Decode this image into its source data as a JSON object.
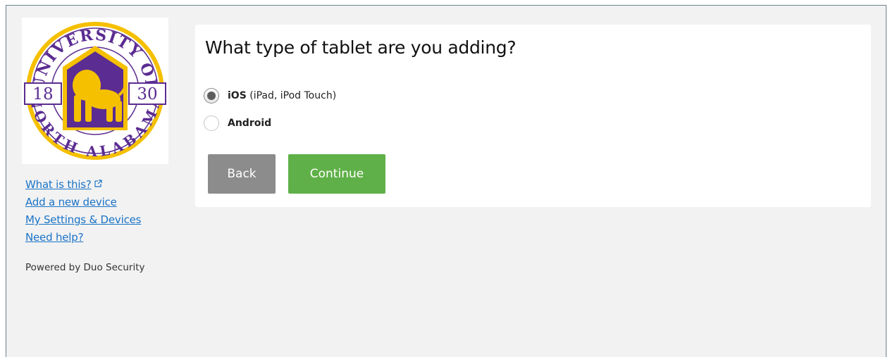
{
  "sidebar": {
    "logo": {
      "arc_top": "UNIVERSITY OF",
      "arc_bottom": "NORTH ALABAMA",
      "year_left": "18",
      "year_right": "30",
      "colors": {
        "gold": "#f5c000",
        "purple": "#5b2c91",
        "ring": "#ffffff"
      }
    },
    "links": [
      {
        "label": "What is this?",
        "icon": "external-link-icon"
      },
      {
        "label": "Add a new device"
      },
      {
        "label": "My Settings & Devices"
      },
      {
        "label": "Need help?"
      }
    ],
    "powered_by": "Powered by Duo Security"
  },
  "panel": {
    "title": "What type of tablet are you adding?",
    "options": [
      {
        "label_bold": "iOS",
        "label_rest": " (iPad, iPod Touch)",
        "selected": true
      },
      {
        "label_bold": "Android",
        "label_rest": "",
        "selected": false
      }
    ],
    "buttons": {
      "back": "Back",
      "continue": "Continue"
    }
  },
  "colors": {
    "link": "#1a73c7",
    "back_button": "#8c8c8c",
    "continue_button": "#5fb048",
    "background": "#f2f2f2",
    "frame_border": "#6e7f8d"
  }
}
